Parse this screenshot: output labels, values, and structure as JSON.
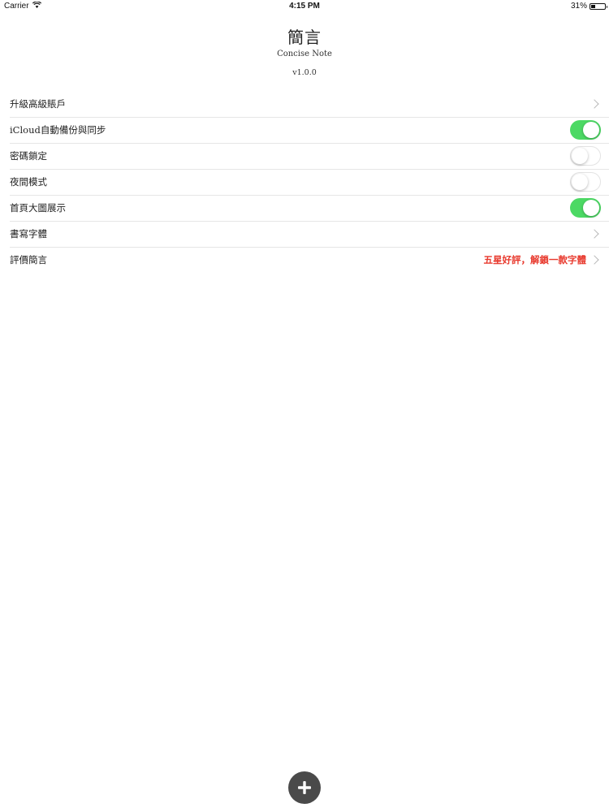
{
  "status_bar": {
    "carrier": "Carrier",
    "wifi_icon": "wifi-icon",
    "time": "4:15 PM",
    "battery_percent": "31%",
    "battery_level": 0.31,
    "battery_icon": "battery-icon"
  },
  "header": {
    "title": "簡言",
    "subtitle": "Concise Note",
    "version": "v1.0.0"
  },
  "settings": {
    "items": [
      {
        "label": "升級高級賬戶",
        "type": "disclosure",
        "detail": ""
      },
      {
        "label": "iCloud自動備份與同步",
        "type": "toggle",
        "on": true
      },
      {
        "label": "密碼鎖定",
        "type": "toggle",
        "on": false
      },
      {
        "label": "夜間模式",
        "type": "toggle",
        "on": false
      },
      {
        "label": "首頁大圖展示",
        "type": "toggle",
        "on": true
      },
      {
        "label": "書寫字體",
        "type": "disclosure",
        "detail": ""
      },
      {
        "label": "評價簡言",
        "type": "disclosure",
        "detail": "五星好評，解鎖一款字體"
      }
    ]
  },
  "fab": {
    "icon": "plus-icon"
  },
  "colors": {
    "toggle_on": "#4cd964",
    "detail_red": "#e8392d",
    "fab_bg": "#4a4a4a"
  }
}
